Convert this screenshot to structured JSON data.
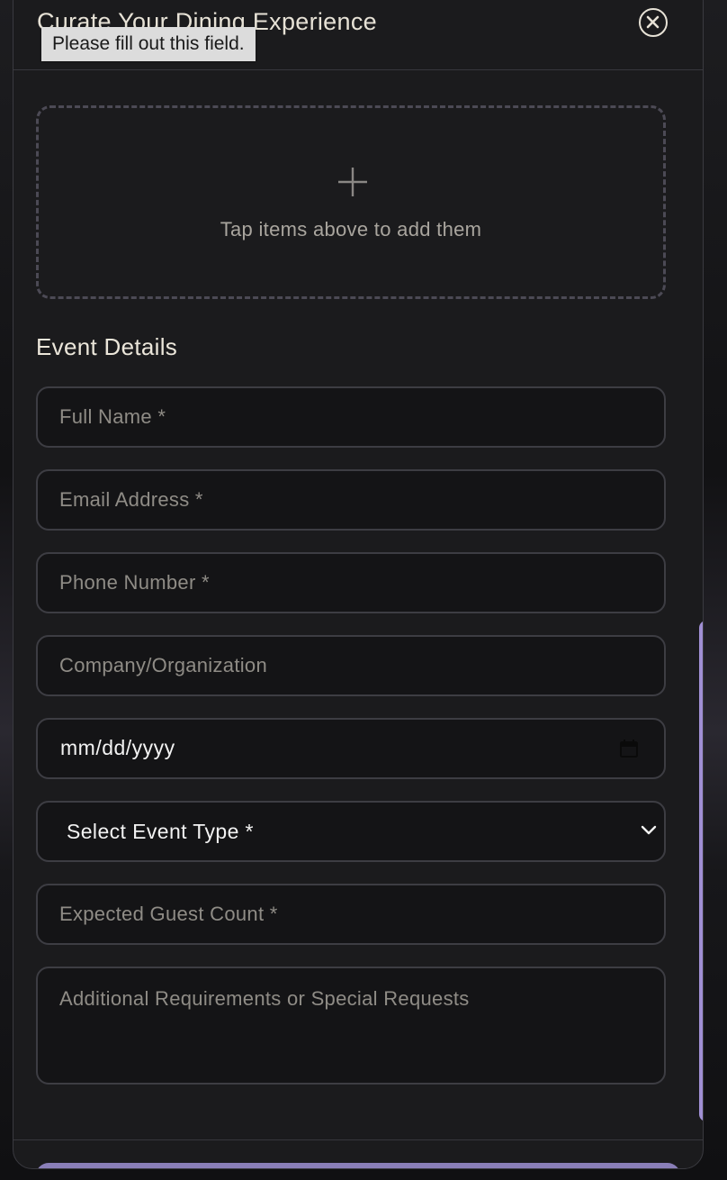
{
  "modal": {
    "title": "Curate Your Dining Experience",
    "close_icon": "close-circle-icon"
  },
  "tooltip": {
    "text": "Please fill out this field."
  },
  "dropzone": {
    "icon": "plus-icon",
    "text": "Tap items above to add them"
  },
  "form": {
    "section_title": "Event Details",
    "full_name": {
      "placeholder": "Full Name *",
      "value": ""
    },
    "email": {
      "placeholder": "Email Address *",
      "value": ""
    },
    "phone": {
      "placeholder": "Phone Number *",
      "value": ""
    },
    "company": {
      "placeholder": "Company/Organization",
      "value": ""
    },
    "date": {
      "display": "mm/dd/yyyy",
      "icon": "calendar-icon"
    },
    "event_type": {
      "selected": "Select Event Type *",
      "icon": "chevron-down-icon"
    },
    "guest_count": {
      "placeholder": "Expected Guest Count *",
      "value": ""
    },
    "requests": {
      "placeholder": "Additional Requirements or Special Requests",
      "value": ""
    }
  },
  "colors": {
    "accent": "#a08fd4",
    "modal_bg": "#1b1b1d",
    "field_bg": "#141416",
    "text_primary": "#e7e2d6",
    "placeholder": "#8f8c86"
  }
}
